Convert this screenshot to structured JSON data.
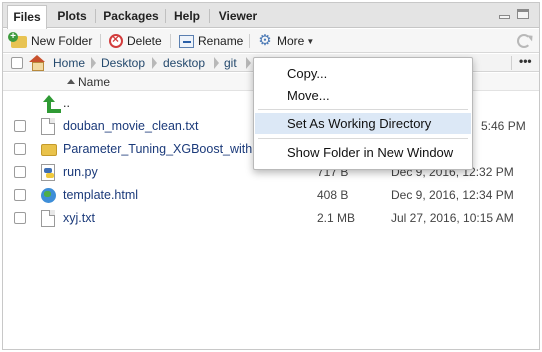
{
  "tabs": [
    {
      "label": "Files",
      "active": true
    },
    {
      "label": "Plots",
      "active": false
    },
    {
      "label": "Packages",
      "active": false
    },
    {
      "label": "Help",
      "active": false
    },
    {
      "label": "Viewer",
      "active": false
    }
  ],
  "toolbar": {
    "new_folder": "New Folder",
    "delete": "Delete",
    "rename": "Rename",
    "more": "More",
    "icons": {
      "new_folder": "new-folder-icon",
      "delete": "delete-icon",
      "rename": "rename-icon",
      "more": "gear-icon",
      "refresh": "refresh-icon"
    }
  },
  "breadcrumb": [
    "Home",
    "Desktop",
    "desktop",
    "git"
  ],
  "breadcrumb_more": "•••",
  "columns": {
    "name": "Name"
  },
  "files": [
    {
      "name": "..",
      "size": "",
      "modified": "",
      "icon": "up-arrow-icon"
    },
    {
      "name": "douban_movie_clean.txt",
      "size": "",
      "modified": "5:46 PM",
      "icon": "file-icon"
    },
    {
      "name": "Parameter_Tuning_XGBoost_with",
      "size": "",
      "modified": "",
      "icon": "folder-icon"
    },
    {
      "name": "run.py",
      "size": "717 B",
      "modified": "Dec 9, 2016, 12:32 PM",
      "icon": "python-file-icon"
    },
    {
      "name": "template.html",
      "size": "408 B",
      "modified": "Dec 9, 2016, 12:34 PM",
      "icon": "html-file-icon"
    },
    {
      "name": "xyj.txt",
      "size": "2.1 MB",
      "modified": "Jul 27, 2016, 10:15 AM",
      "icon": "file-icon"
    }
  ],
  "menu": {
    "items": [
      {
        "label": "Copy...",
        "highlighted": false
      },
      {
        "label": "Move...",
        "highlighted": false
      },
      {
        "label": "Set As Working Directory",
        "highlighted": true
      },
      {
        "label": "Show Folder in New Window",
        "highlighted": false
      }
    ]
  },
  "colors": {
    "link": "#1b3a7a",
    "highlight": "#dce8f6",
    "crumb": "#24496d"
  }
}
